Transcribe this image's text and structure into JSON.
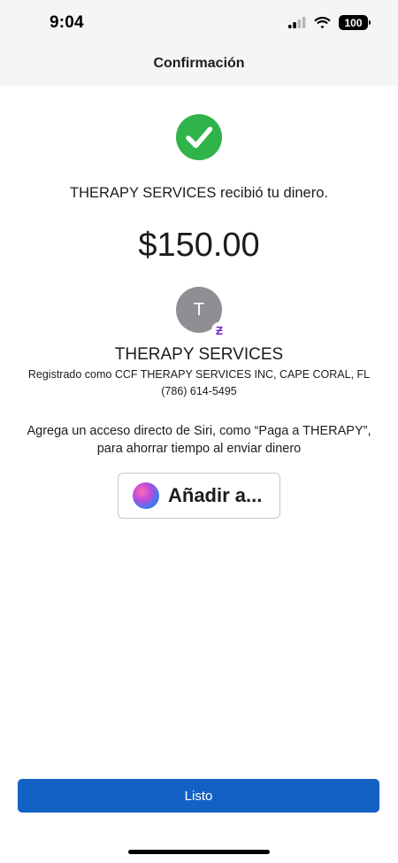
{
  "status_bar": {
    "time": "9:04",
    "battery_level": "100",
    "icons": [
      "cellular-signal-icon",
      "wifi-icon",
      "battery-icon"
    ]
  },
  "header": {
    "title": "Confirmación"
  },
  "confirmation": {
    "icon": "check-circle-icon",
    "message": "THERAPY SERVICES recibió tu dinero.",
    "amount": "$150.00"
  },
  "recipient": {
    "avatar_initial": "T",
    "badge_icon": "zelle-icon",
    "name": "THERAPY SERVICES",
    "registered_as": "Registrado como CCF THERAPY SERVICES INC, CAPE CORAL, FL",
    "phone": "(786) 614-5495"
  },
  "siri": {
    "prompt_line1": "Agrega un acceso directo de Siri, como “Paga a THERAPY”,",
    "prompt_line2": "para ahorrar tiempo al enviar dinero",
    "button_label": "Añadir a...",
    "icon": "siri-icon"
  },
  "footer": {
    "done_label": "Listo"
  },
  "colors": {
    "success_green": "#2fb34a",
    "primary_blue": "#1461c4",
    "zelle_purple": "#6d1ed4",
    "avatar_gray": "#8e8e93",
    "header_bg": "#f4f5f7"
  }
}
